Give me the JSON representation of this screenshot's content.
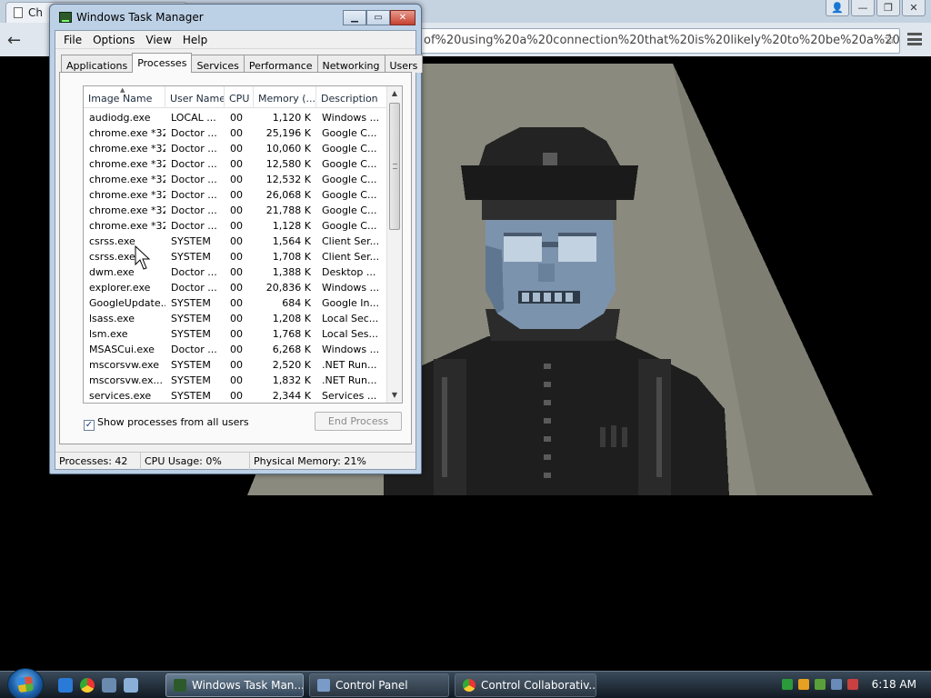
{
  "browser": {
    "tab_title": "Ch",
    "url": "of%20using%20a%20connection%20that%20is%20likely%20to%20be%20a%20%"
  },
  "task_manager": {
    "title": "Windows Task Manager",
    "menu": [
      "File",
      "Options",
      "View",
      "Help"
    ],
    "tabs": [
      "Applications",
      "Processes",
      "Services",
      "Performance",
      "Networking",
      "Users"
    ],
    "active_tab": "Processes",
    "columns": [
      "Image Name",
      "User Name",
      "CPU",
      "Memory (...",
      "Description"
    ],
    "processes": [
      [
        "audiodg.exe",
        "LOCAL ...",
        "00",
        "1,120 K",
        "Windows ..."
      ],
      [
        "chrome.exe *32",
        "Doctor ...",
        "00",
        "25,196 K",
        "Google C..."
      ],
      [
        "chrome.exe *32",
        "Doctor ...",
        "00",
        "10,060 K",
        "Google C..."
      ],
      [
        "chrome.exe *32",
        "Doctor ...",
        "00",
        "12,580 K",
        "Google C..."
      ],
      [
        "chrome.exe *32",
        "Doctor ...",
        "00",
        "12,532 K",
        "Google C..."
      ],
      [
        "chrome.exe *32",
        "Doctor ...",
        "00",
        "26,068 K",
        "Google C..."
      ],
      [
        "chrome.exe *32",
        "Doctor ...",
        "00",
        "21,788 K",
        "Google C..."
      ],
      [
        "chrome.exe *32",
        "Doctor ...",
        "00",
        "1,128 K",
        "Google C..."
      ],
      [
        "csrss.exe",
        "SYSTEM",
        "00",
        "1,564 K",
        "Client Ser..."
      ],
      [
        "csrss.exe",
        "SYSTEM",
        "00",
        "1,708 K",
        "Client Ser..."
      ],
      [
        "dwm.exe",
        "Doctor ...",
        "00",
        "1,388 K",
        "Desktop ..."
      ],
      [
        "explorer.exe",
        "Doctor ...",
        "00",
        "20,836 K",
        "Windows ..."
      ],
      [
        "GoogleUpdate...",
        "SYSTEM",
        "00",
        "684 K",
        "Google In..."
      ],
      [
        "lsass.exe",
        "SYSTEM",
        "00",
        "1,208 K",
        "Local Sec..."
      ],
      [
        "lsm.exe",
        "SYSTEM",
        "00",
        "1,768 K",
        "Local Ses..."
      ],
      [
        "MSASCui.exe",
        "Doctor ...",
        "00",
        "6,268 K",
        "Windows ..."
      ],
      [
        "mscorsvw.exe",
        "SYSTEM",
        "00",
        "2,520 K",
        ".NET Run..."
      ],
      [
        "mscorsvw.ex...",
        "SYSTEM",
        "00",
        "1,832 K",
        ".NET Run..."
      ],
      [
        "services.exe",
        "SYSTEM",
        "00",
        "2,344 K",
        "Services ..."
      ]
    ],
    "show_all_label": "Show processes from all users",
    "show_all_checked": true,
    "end_process_label": "End Process",
    "status": {
      "processes": "Processes: 42",
      "cpu": "CPU Usage: 0%",
      "memory": "Physical Memory: 21%"
    }
  },
  "taskbar": {
    "buttons": [
      "Windows Task Man...",
      "Control Panel",
      "Control Collaborativ..."
    ],
    "clock": "6:18 AM"
  },
  "colors": {
    "game_spotlight": "#8a8a7e",
    "game_skin": "#7c93ad",
    "game_uniform": "#1e1e1e"
  }
}
